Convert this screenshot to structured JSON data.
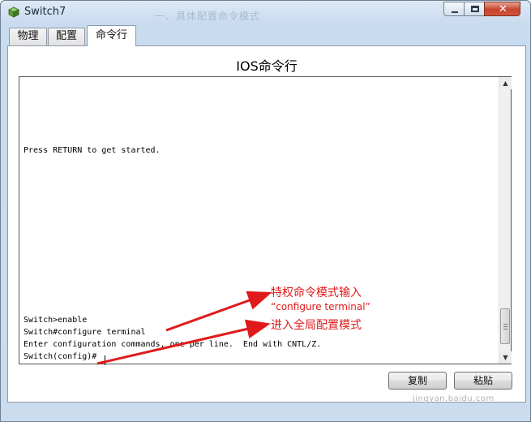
{
  "window": {
    "title": "Switch7",
    "faint_title": "一、具体配置命令模式"
  },
  "tabs": [
    {
      "label": "物理",
      "active": false
    },
    {
      "label": "配置",
      "active": false
    },
    {
      "label": "命令行",
      "active": true
    }
  ],
  "panel": {
    "heading": "IOS命令行"
  },
  "console": {
    "lines": [
      "Press RETURN to get started.",
      "Switch>enable",
      "Switch#configure terminal",
      "Enter configuration commands, one per line.  End with CNTL/Z.",
      "Switch(config)#"
    ]
  },
  "buttons": {
    "copy": "复制",
    "paste": "粘贴"
  },
  "annotation": {
    "line1": "特权命令模式输入",
    "line2": "“configure terminal”",
    "line3": "进入全局配置模式",
    "color": "#e01a1a"
  },
  "watermark": "jingyan.baidu.com"
}
